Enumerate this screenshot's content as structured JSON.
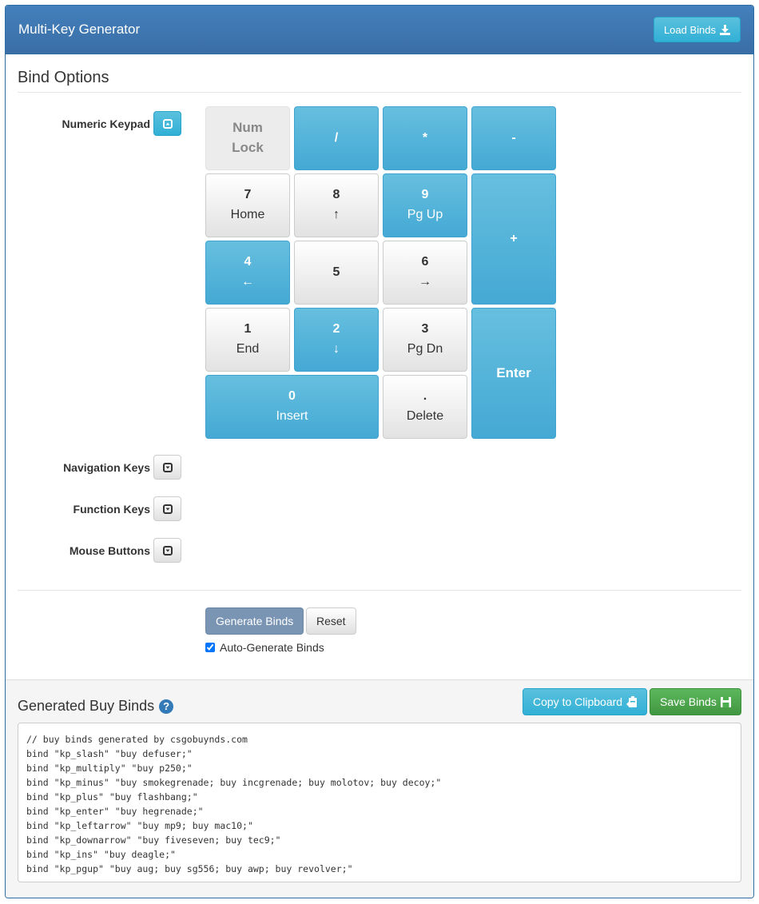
{
  "header": {
    "title": "Multi-Key Generator",
    "load_binds_label": "Load Binds"
  },
  "bind_options": {
    "legend": "Bind Options",
    "sections": [
      {
        "label": "Numeric Keypad",
        "expanded": true
      },
      {
        "label": "Navigation Keys",
        "expanded": false
      },
      {
        "label": "Function Keys",
        "expanded": false
      },
      {
        "label": "Mouse Buttons",
        "expanded": false
      }
    ],
    "keypad": {
      "numlock": {
        "main": "Num",
        "sub": "Lock",
        "state": "disabled"
      },
      "slash": {
        "main": "/",
        "state": "bound"
      },
      "multiply": {
        "main": "*",
        "state": "bound"
      },
      "minus": {
        "main": "-",
        "state": "bound"
      },
      "k7": {
        "main": "7",
        "sub": "Home",
        "state": "unbound"
      },
      "k8": {
        "main": "8",
        "sub": "↑",
        "state": "unbound"
      },
      "k9": {
        "main": "9",
        "sub": "Pg Up",
        "state": "bound"
      },
      "plus": {
        "main": "+",
        "state": "bound"
      },
      "k4": {
        "main": "4",
        "sub": "←",
        "state": "bound"
      },
      "k5": {
        "main": "5",
        "state": "unbound"
      },
      "k6": {
        "main": "6",
        "sub": "→",
        "state": "unbound"
      },
      "k1": {
        "main": "1",
        "sub": "End",
        "state": "unbound"
      },
      "k2": {
        "main": "2",
        "sub": "↓",
        "state": "bound"
      },
      "k3": {
        "main": "3",
        "sub": "Pg Dn",
        "state": "unbound"
      },
      "enter": {
        "main": "Enter",
        "state": "bound"
      },
      "k0": {
        "main": "0",
        "sub": "Insert",
        "state": "bound"
      },
      "dot": {
        "main": ".",
        "sub": "Delete",
        "state": "unbound"
      }
    },
    "generate_label": "Generate Binds",
    "reset_label": "Reset",
    "auto_generate_label": "Auto-Generate Binds",
    "auto_generate_checked": true
  },
  "generated": {
    "title": "Generated Buy Binds",
    "copy_label": "Copy to Clipboard",
    "save_label": "Save Binds",
    "lines": [
      "// buy binds generated by csgobuynds.com",
      "bind \"kp_slash\" \"buy defuser;\"",
      "bind \"kp_multiply\" \"buy p250;\"",
      "bind \"kp_minus\" \"buy smokegrenade; buy incgrenade; buy molotov; buy decoy;\"",
      "bind \"kp_plus\" \"buy flashbang;\"",
      "bind \"kp_enter\" \"buy hegrenade;\"",
      "bind \"kp_leftarrow\" \"buy mp9; buy mac10;\"",
      "bind \"kp_downarrow\" \"buy fiveseven; buy tec9;\"",
      "bind \"kp_ins\" \"buy deagle;\"",
      "bind \"kp_pgup\" \"buy aug; buy sg556; buy awp; buy revolver;\""
    ]
  },
  "colors": {
    "header_bg": "#3a6ea5",
    "bound_key": "#5bc0de",
    "save_green": "#5cb85c",
    "help_blue": "#337ab7"
  }
}
